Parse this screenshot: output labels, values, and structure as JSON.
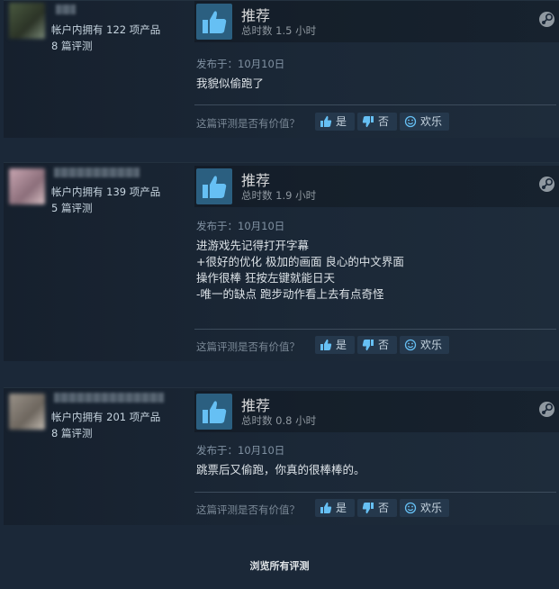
{
  "reviews": [
    {
      "products": "帐户内拥有 122 项产品",
      "review_count": "8 篇评测",
      "verdict": "推荐",
      "hours": "总时数 1.5 小时",
      "posted": "发布于：10月10日",
      "text": "我貌似偷跑了",
      "helpful_q": "这篇评测是否有价值？",
      "yes": "是",
      "no": "否",
      "funny": "欢乐"
    },
    {
      "products": "帐户内拥有 139 项产品",
      "review_count": "5 篇评测",
      "verdict": "推荐",
      "hours": "总时数 1.9 小时",
      "posted": "发布于：10月10日",
      "text": "进游戏先记得打开字幕\n+很好的优化 极加的画面 良心的中文界面\n操作很棒 狂按左键就能日天\n-唯一的缺点 跑步动作看上去有点奇怪",
      "helpful_q": "这篇评测是否有价值？",
      "yes": "是",
      "no": "否",
      "funny": "欢乐"
    },
    {
      "products": "帐户内拥有 201 项产品",
      "review_count": "8 篇评测",
      "verdict": "推荐",
      "hours": "总时数 0.8 小时",
      "posted": "发布于：10月10日",
      "text": "跳票后又偷跑，你真的很棒棒的。",
      "helpful_q": "这篇评测是否有价值？",
      "yes": "是",
      "no": "否",
      "funny": "欢乐"
    }
  ],
  "see_all": "浏览所有评测",
  "icons": {
    "thumb": "thumbs-up-icon",
    "steam": "steam-logo-icon"
  },
  "colors": {
    "background": "#1b2838",
    "thumb_box": "#2b5f80",
    "button": "#25384c"
  }
}
